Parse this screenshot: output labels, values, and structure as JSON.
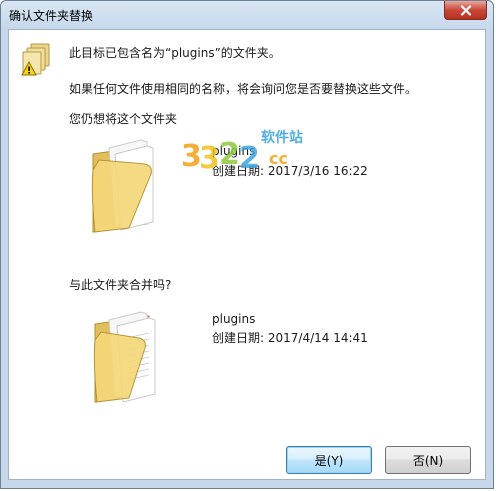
{
  "window": {
    "title": "确认文件夹替换"
  },
  "message": {
    "line1": "此目标已包含名为“plugins”的文件夹。",
    "line2": "如果任何文件使用相同的名称，将会询问您是否要替换这些文件。",
    "line3": "您仍想将这个文件夹",
    "line4": "与此文件夹合并吗?"
  },
  "source_folder": {
    "name": "plugins",
    "created": "创建日期: 2017/3/16 16:22"
  },
  "target_folder": {
    "name": "plugins",
    "created": "创建日期: 2017/4/14 14:41"
  },
  "watermark": {
    "digits": "3322",
    "cn": "软件站",
    "domain": "cc"
  },
  "buttons": {
    "yes": "是(Y)",
    "no": "否(N)"
  },
  "icons": {
    "title_close": "close-icon",
    "warning": "folder-warning-icon",
    "folder": "folder-icon"
  }
}
